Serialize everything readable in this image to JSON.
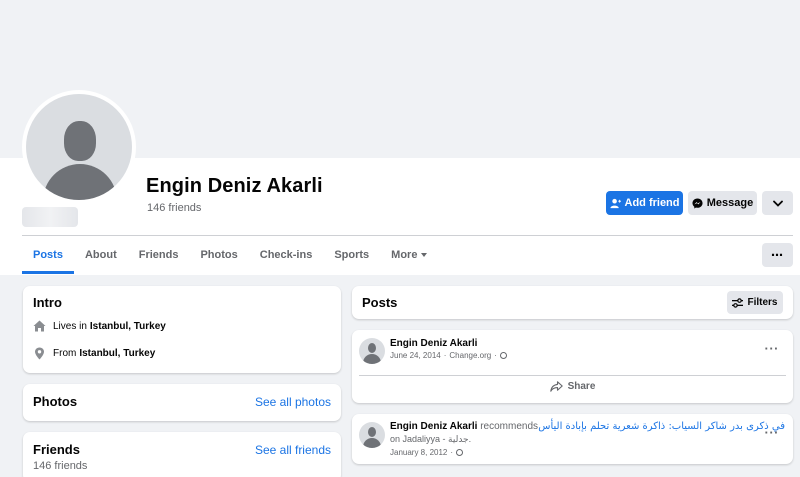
{
  "profile": {
    "name": "Engin Deniz Akarli",
    "friends_count": "146 friends"
  },
  "actions": {
    "add_friend": "Add friend",
    "message": "Message",
    "more_options": "⋯"
  },
  "tabs": [
    {
      "label": "Posts",
      "active": true
    },
    {
      "label": "About"
    },
    {
      "label": "Friends"
    },
    {
      "label": "Photos"
    },
    {
      "label": "Check-ins"
    },
    {
      "label": "Sports"
    },
    {
      "label": "More"
    }
  ],
  "intro": {
    "title": "Intro",
    "lives_prefix": "Lives in",
    "lives_place": "Istanbul, Turkey",
    "from_prefix": "From",
    "from_place": "Istanbul, Turkey"
  },
  "photos": {
    "title": "Photos",
    "link": "See all photos"
  },
  "friends": {
    "title": "Friends",
    "link": "See all friends",
    "count": "146 friends"
  },
  "posts": {
    "title": "Posts",
    "filters": "Filters",
    "items": [
      {
        "author": "Engin Deniz Akarli",
        "date": "June 24, 2014",
        "source": "Change.org",
        "share": "Share"
      },
      {
        "author": "Engin Deniz Akarli",
        "verb": "recommends",
        "title_ar": "في ذكرى بدر شاكر السياب: ذاكرة شعرية تحلم بإبادة اليأس",
        "on": "on Jadaliyya - جدلية.",
        "date": "January 8, 2012"
      }
    ]
  },
  "colors": {
    "accent": "#1b74e4",
    "background": "#f0f2f5",
    "card": "#ffffff",
    "muted_text": "#65676b"
  }
}
